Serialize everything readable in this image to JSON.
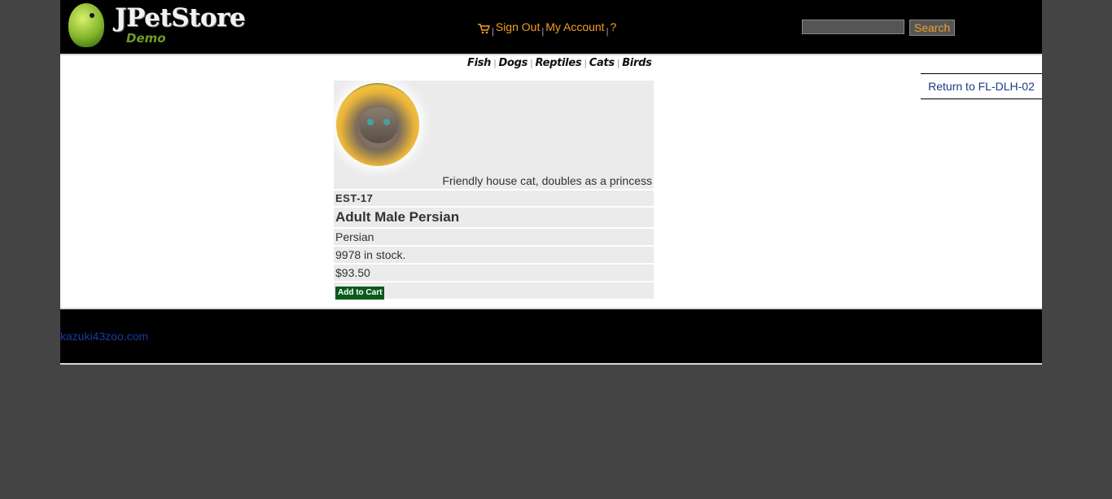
{
  "header": {
    "logo_title": "JPetStore",
    "logo_subtitle": "Demo",
    "menu": {
      "sign_out": "Sign Out",
      "my_account": "My Account",
      "help": "?"
    },
    "search": {
      "value": "",
      "button_label": "Search"
    }
  },
  "quicklinks": [
    "Fish",
    "Dogs",
    "Reptiles",
    "Cats",
    "Birds"
  ],
  "back_link": "Return to FL-DLH-02",
  "item": {
    "description": "Friendly house cat, doubles as a princess",
    "id": "EST-17",
    "name": "Adult Male Persian",
    "product": "Persian",
    "stock": "9978 in stock.",
    "price": "$93.50",
    "add_to_cart": "Add to Cart"
  },
  "footer": {
    "domain": "kazuki43zoo.com"
  },
  "colors": {
    "page_bg": "#444444",
    "header_bg": "#000000",
    "menu_link": "#f0a020",
    "add_to_cart_bg": "#0a5a1a",
    "return_link": "#1a3a8a"
  }
}
